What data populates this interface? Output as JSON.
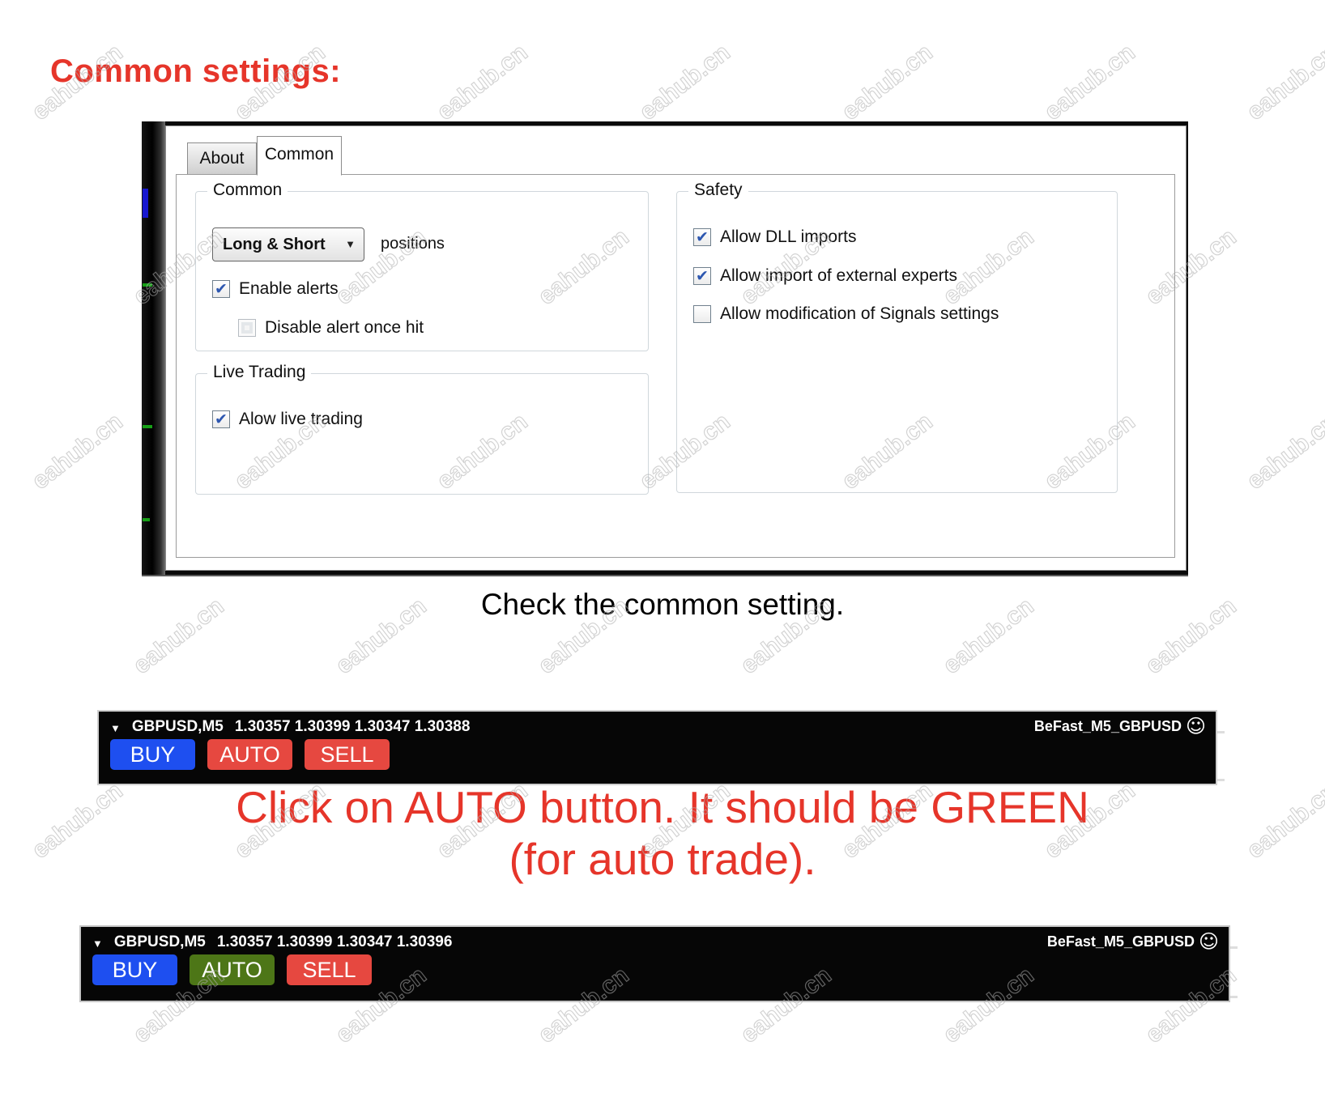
{
  "page": {
    "heading": "Common settings:",
    "caption": "Check the common setting.",
    "instruction": {
      "line1": "Click on AUTO button. It should be GREEN",
      "line2": "(for auto trade)."
    },
    "watermark_text": "eahub.cn"
  },
  "colors": {
    "accent_red": "#e6352a",
    "buy_blue": "#1e4ff0",
    "button_red": "#e64840",
    "auto_green": "#4d7617"
  },
  "icons": {
    "marker_arrow": "▼",
    "dropdown_arrow": "▼",
    "smiley": "☺",
    "check": "✔"
  },
  "dialog": {
    "tabs": [
      {
        "label": "About",
        "active": false
      },
      {
        "label": "Common",
        "active": true
      }
    ],
    "common_group": {
      "title": "Common",
      "dropdown": {
        "value": "Long & Short",
        "suffix_label": "positions"
      },
      "checkboxes": [
        {
          "label": "Enable alerts",
          "checked": true,
          "disabled": false,
          "mark": "✔"
        },
        {
          "label": "Disable alert once hit",
          "checked": false,
          "disabled": true,
          "mark": ""
        }
      ]
    },
    "live_group": {
      "title": "Live Trading",
      "checkboxes": [
        {
          "label": "Alow live trading",
          "checked": true,
          "disabled": false,
          "mark": "✔"
        }
      ]
    },
    "safety_group": {
      "title": "Safety",
      "checkboxes": [
        {
          "label": "Allow DLL imports",
          "checked": true,
          "disabled": false,
          "mark": "✔"
        },
        {
          "label": "Allow import of external experts",
          "checked": true,
          "disabled": false,
          "mark": "✔"
        },
        {
          "label": "Allow modification of Signals settings",
          "checked": false,
          "disabled": false,
          "mark": ""
        }
      ]
    }
  },
  "bars": [
    {
      "symbol": "GBPUSD,M5",
      "prices": "1.30357 1.30399 1.30347 1.30388",
      "ea_name": "BeFast_M5_GBPUSD",
      "buttons": [
        {
          "label": "BUY",
          "color": "#1e4ff0"
        },
        {
          "label": "AUTO",
          "color": "#e64840"
        },
        {
          "label": "SELL",
          "color": "#e64840"
        }
      ]
    },
    {
      "symbol": "GBPUSD,M5",
      "prices": "1.30357 1.30399 1.30347 1.30396",
      "ea_name": "BeFast_M5_GBPUSD",
      "buttons": [
        {
          "label": "BUY",
          "color": "#1e4ff0"
        },
        {
          "label": "AUTO",
          "color": "#4d7617"
        },
        {
          "label": "SELL",
          "color": "#e64840"
        }
      ]
    }
  ]
}
